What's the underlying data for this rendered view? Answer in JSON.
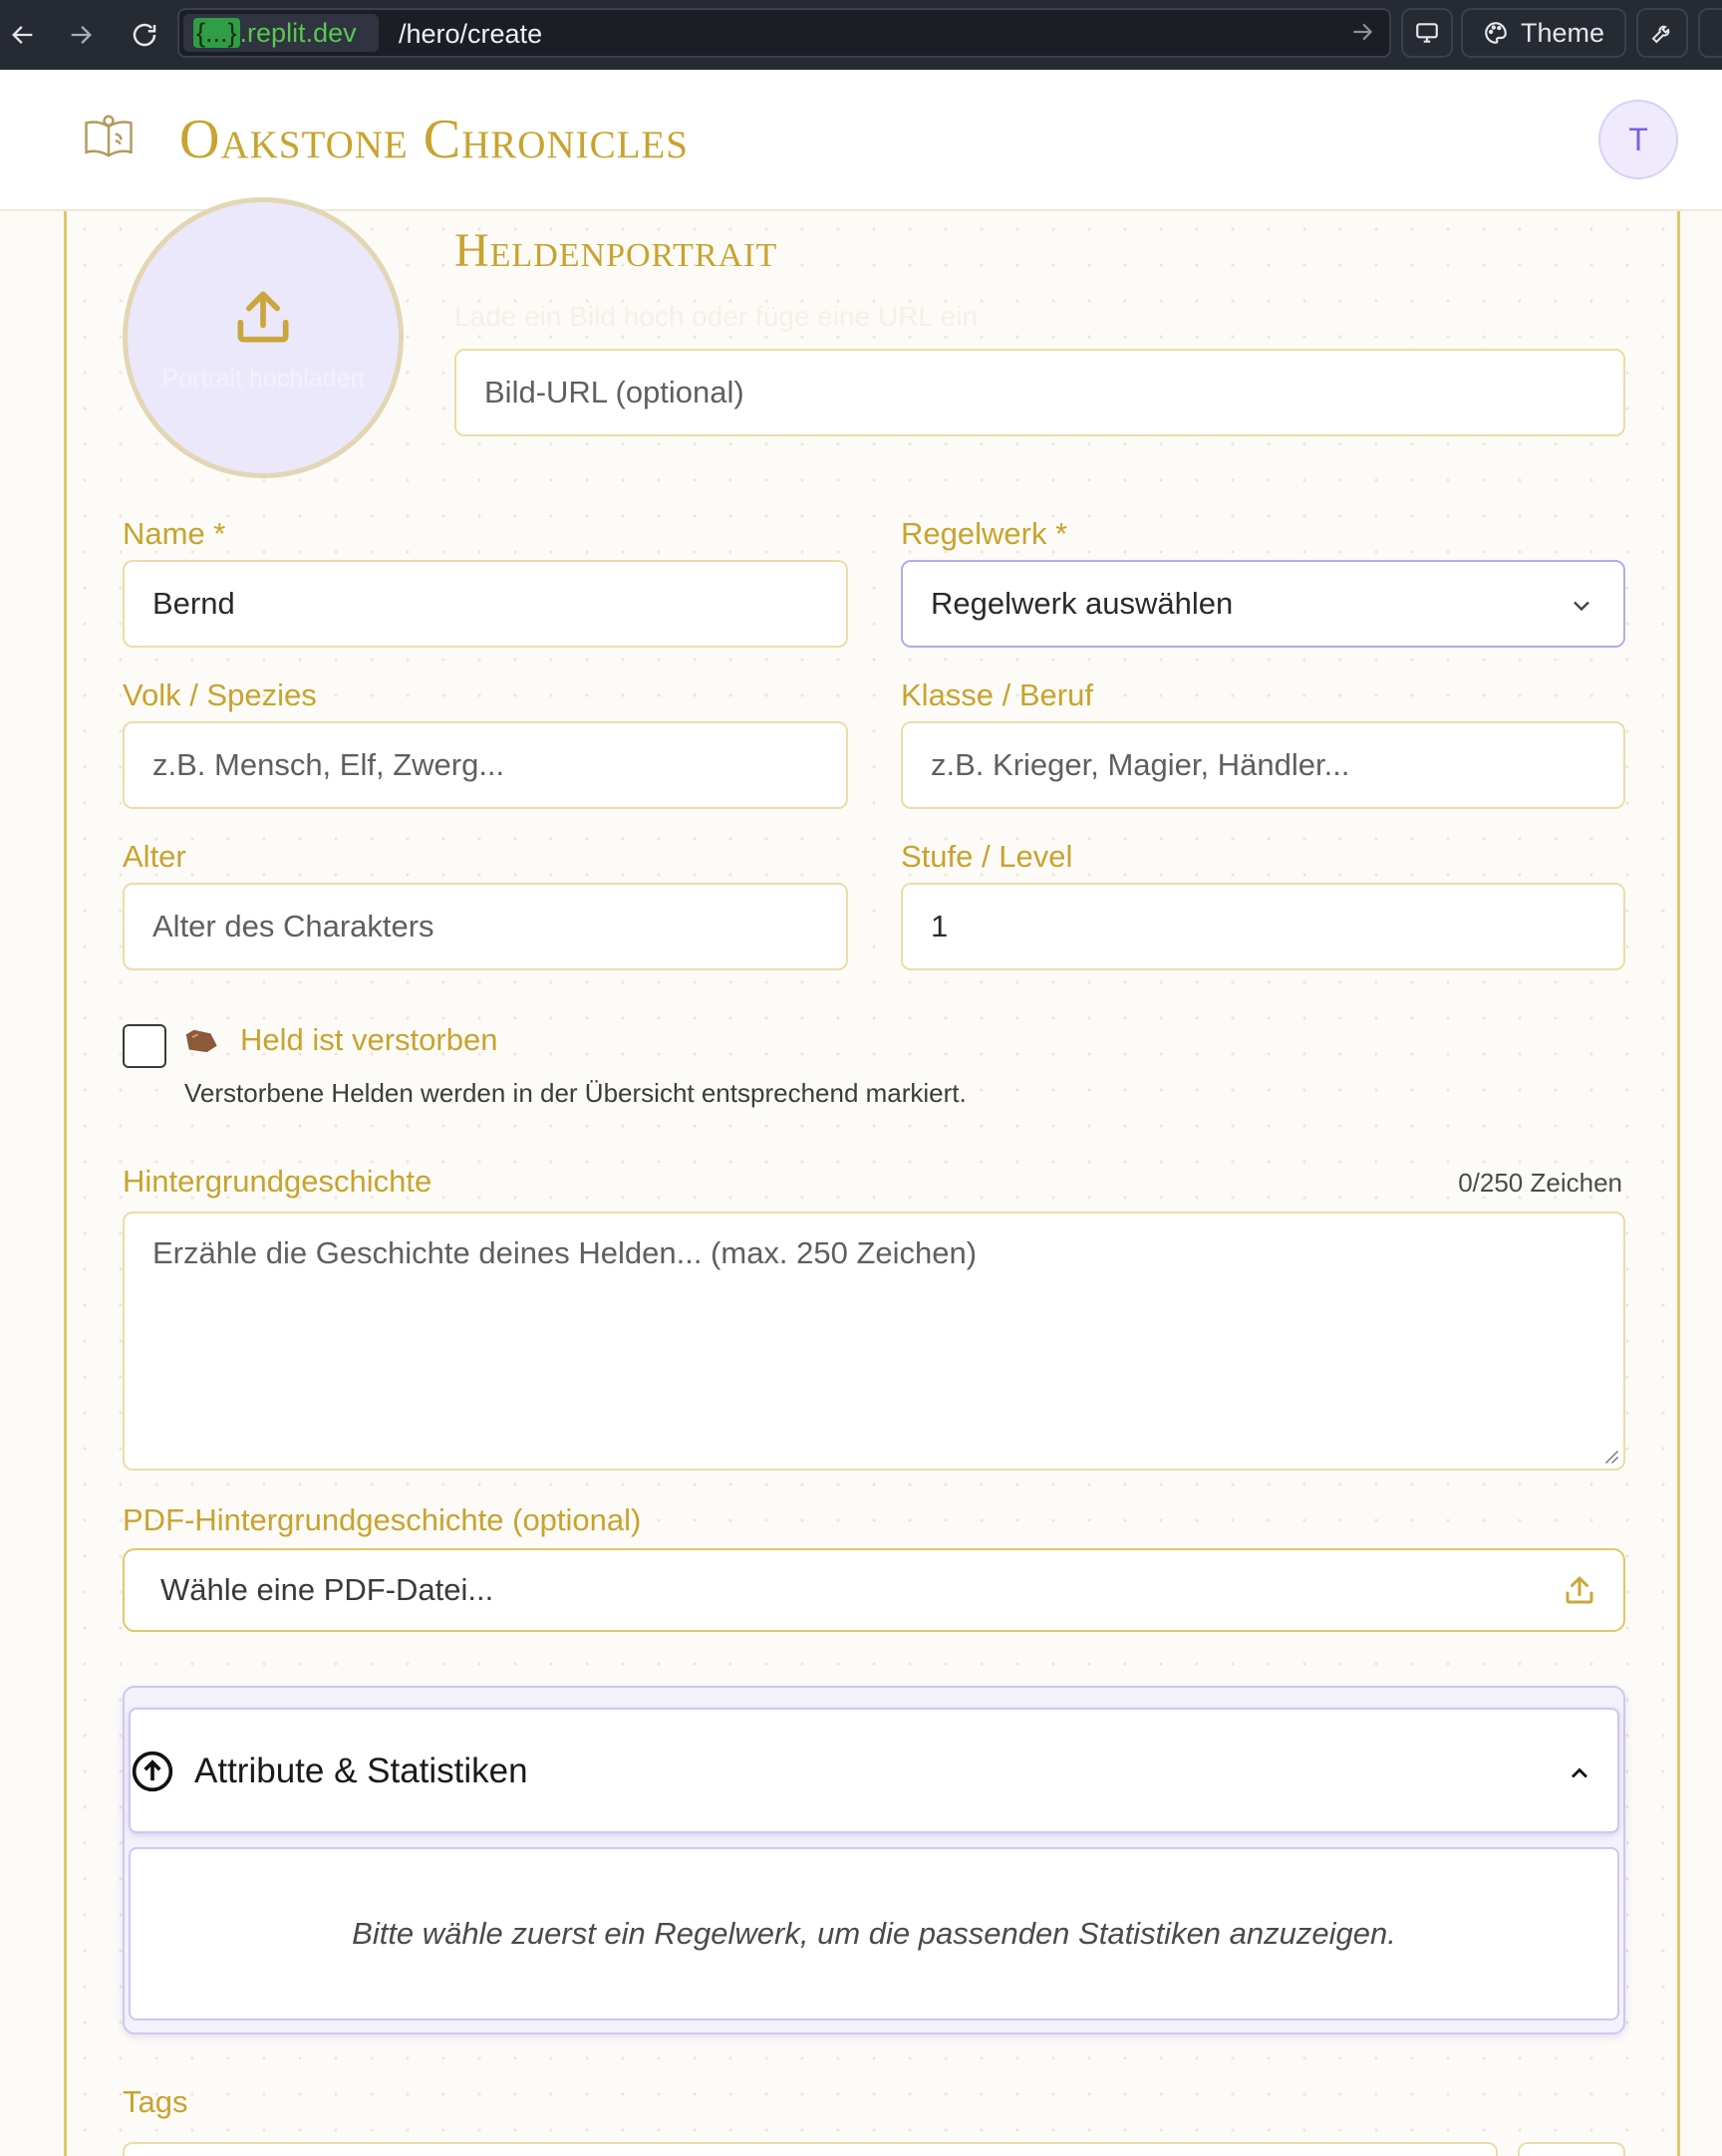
{
  "browser": {
    "url_host_prefix": "{...}",
    "url_host": ".replit.dev",
    "url_path": "/hero/create",
    "theme_label": "Theme"
  },
  "header": {
    "app_title": "Oakstone Chronicles",
    "avatar_initial": "T"
  },
  "portrait": {
    "upload_label": "Portrait hochladen",
    "heading": "Heldenportrait",
    "subtitle": "Lade ein Bild hoch oder füge eine URL ein",
    "url_placeholder": "Bild-URL (optional)"
  },
  "form": {
    "name": {
      "label": "Name *",
      "value": "Bernd"
    },
    "ruleset": {
      "label": "Regelwerk *",
      "value": "Regelwerk auswählen"
    },
    "species": {
      "label": "Volk / Spezies",
      "placeholder": "z.B. Mensch, Elf, Zwerg..."
    },
    "class": {
      "label": "Klasse / Beruf",
      "placeholder": "z.B. Krieger, Magier, Händler..."
    },
    "age": {
      "label": "Alter",
      "placeholder": "Alter des Charakters"
    },
    "level": {
      "label": "Stufe / Level",
      "value": "1"
    },
    "deceased": {
      "label": "Held ist verstorben",
      "hint": "Verstorbene Helden werden in der Übersicht entsprechend markiert.",
      "checked": false
    },
    "backstory": {
      "label": "Hintergrundgeschichte",
      "counter": "0/250 Zeichen",
      "placeholder": "Erzähle die Geschichte deines Helden... (max. 250 Zeichen)"
    },
    "pdf": {
      "label": "PDF-Hintergrundgeschichte (optional)",
      "placeholder": "Wähle eine PDF-Datei..."
    },
    "attributes": {
      "title": "Attribute & Statistiken",
      "message": "Bitte wähle zuerst ein Regelwerk, um die passenden Statistiken anzuzeigen."
    },
    "tags": {
      "label": "Tags"
    }
  },
  "colors": {
    "gold": "#c8a32e",
    "lavender": "#ebe8fb",
    "browser_bar": "#262a33"
  }
}
